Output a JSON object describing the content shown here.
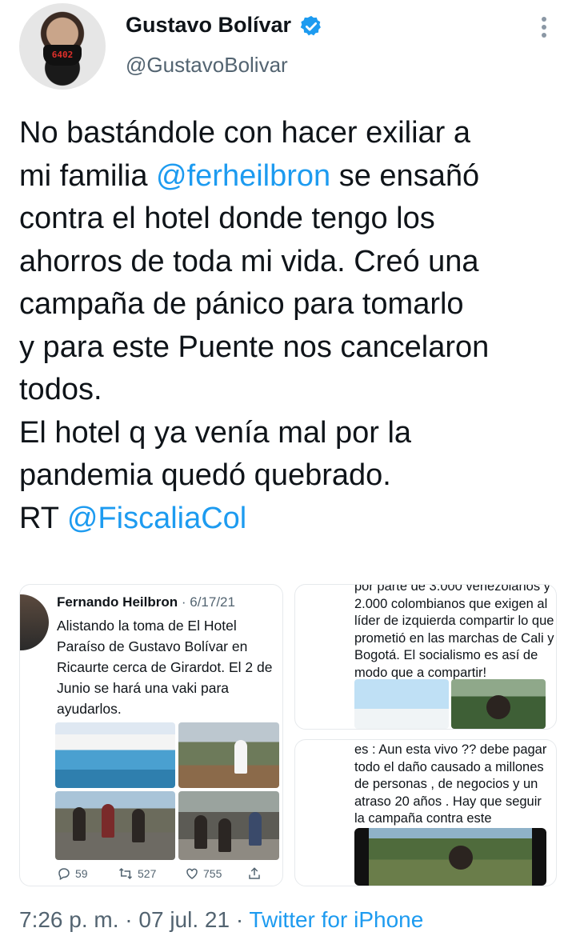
{
  "author": {
    "name": "Gustavo Bolívar",
    "handle": "@GustavoBolivar",
    "avatar_mask_text": "6402"
  },
  "tweet": {
    "part1": "No bastándole con hacer exiliar a\nmi familia ",
    "mention1": "@ferheilbron",
    "part2": " se ensañó\ncontra el hotel donde tengo los\nahorros de toda mi vida. Creó una\ncampaña de pánico para tomarlo\ny para este Puente nos cancelaron\ntodos.\nEl hotel q ya venía mal por la\npandemia quedó quebrado.\nRT ",
    "mention2": "@FiscaliaCol"
  },
  "embedded": {
    "card1": {
      "author": "Fernando Heilbron",
      "date": "· 6/17/21",
      "text": "Alistando la toma de El Hotel Paraíso de Gustavo Bolívar en Ricaurte  cerca de Girardot. El 2 de Junio se hará una vaki para ayudarlos.",
      "replies": "59",
      "retweets": "527",
      "likes": "755"
    },
    "card2": {
      "text": "por parte de 3.000 venezolanos y 2.000 colombianos que exigen al líder de izquierda compartir lo que prometió en las marchas de Cali y Bogotá. El socialismo es así de modo que a compartir!"
    },
    "card3": {
      "text": "es : Aun esta vivo ?? debe pagar todo el daño causado a millones de personas , de negocios y un atraso 20 años . Hay que seguir la campaña contra este terrorista.-"
    }
  },
  "footer": {
    "time_date": "7:26 p. m. · 07 jul. 21 · ",
    "source": "Twitter for iPhone"
  },
  "colors": {
    "link": "#1d9bf0",
    "secondary_text": "#536471",
    "verified": "#1d9bf0"
  },
  "icons": [
    "verified-badge-icon",
    "more-options-icon",
    "reply-icon",
    "retweet-icon",
    "like-icon",
    "share-icon"
  ]
}
